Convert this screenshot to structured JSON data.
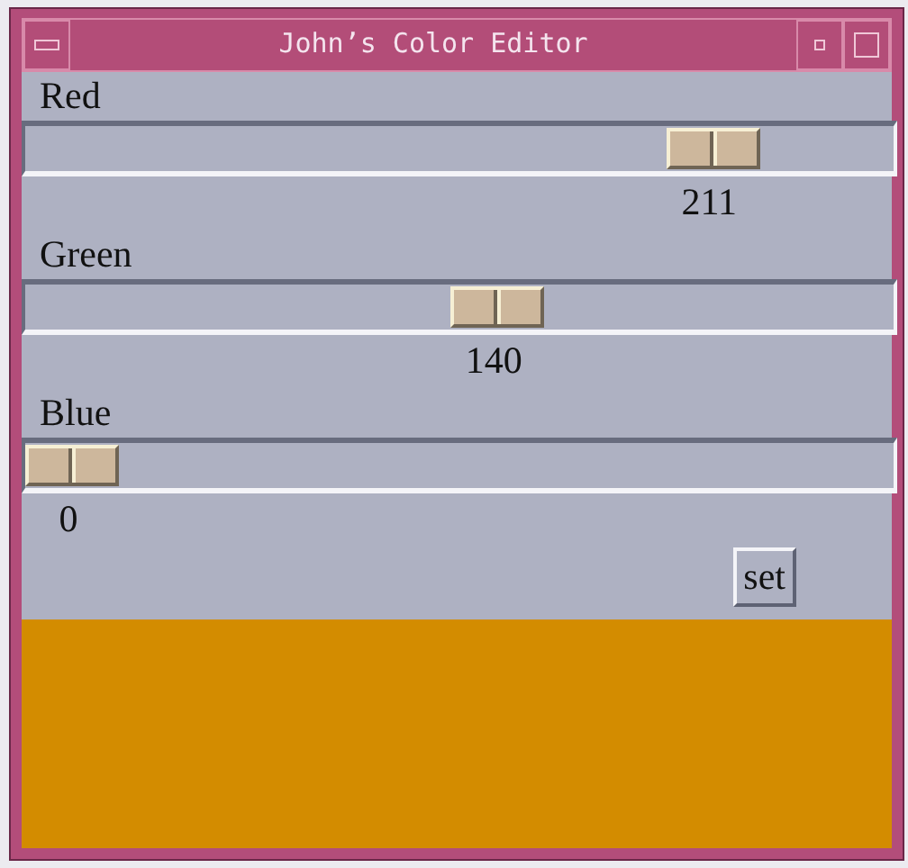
{
  "window": {
    "title": "John’s Color Editor"
  },
  "sliders": [
    {
      "label": "Red",
      "level": 0.827,
      "reading": "211"
    },
    {
      "label": "Green",
      "level": 0.549,
      "reading": "140"
    },
    {
      "label": "Blue",
      "level": 0,
      "reading": "0"
    }
  ],
  "button": "set",
  "swatch": {
    "color": "#d38c00"
  }
}
